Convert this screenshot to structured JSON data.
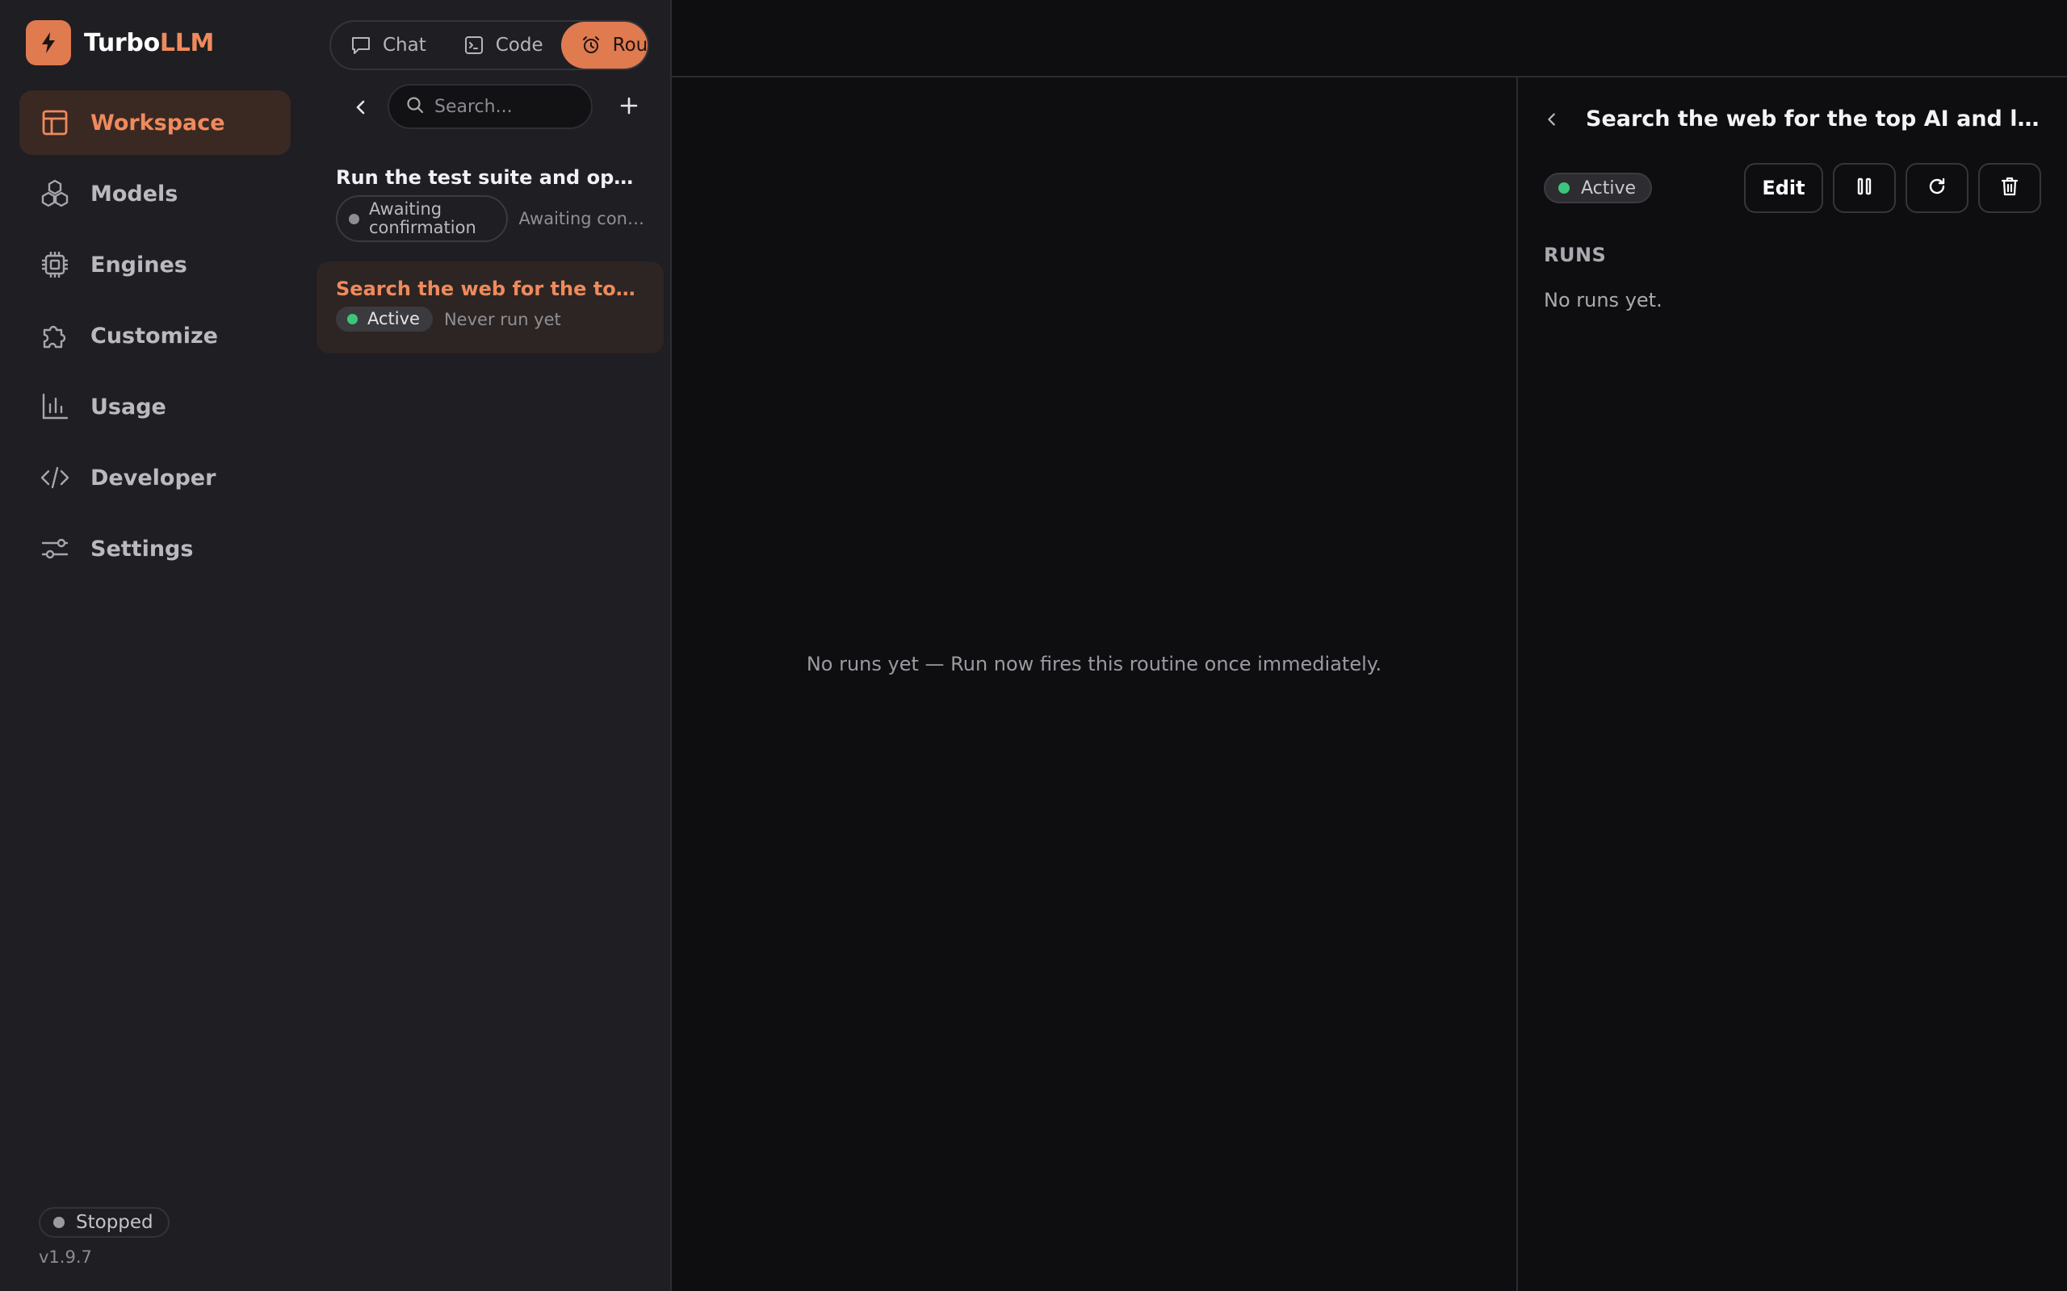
{
  "app": {
    "name_main": "Turbo",
    "name_accent": "LLM"
  },
  "nav": {
    "items": [
      {
        "id": "workspace",
        "label": "Workspace",
        "icon": "layout-icon"
      },
      {
        "id": "models",
        "label": "Models",
        "icon": "cubes-icon"
      },
      {
        "id": "engines",
        "label": "Engines",
        "icon": "cpu-icon"
      },
      {
        "id": "customize",
        "label": "Customize",
        "icon": "puzzle-icon"
      },
      {
        "id": "usage",
        "label": "Usage",
        "icon": "bar-chart-icon"
      },
      {
        "id": "developer",
        "label": "Developer",
        "icon": "code-icon"
      },
      {
        "id": "settings",
        "label": "Settings",
        "icon": "sliders-icon"
      }
    ],
    "active": "workspace"
  },
  "engine": {
    "status": "Stopped",
    "version": "v1.9.7"
  },
  "mode_tabs": {
    "chat": "Chat",
    "code": "Code",
    "routines": "Rout",
    "active": "routines"
  },
  "list": {
    "search_placeholder": "Search...",
    "routines": [
      {
        "title": "Run the test suite and open a ...",
        "status": "Awaiting confirmation",
        "subtext": "Awaiting conf..."
      },
      {
        "title": "Search the web for the top AI ...",
        "status": "Active",
        "subtext": "Never run yet"
      }
    ],
    "selected": 1
  },
  "main": {
    "empty_message": "No runs yet — Run now fires this routine once immediately."
  },
  "detail": {
    "title": "Search the web for the top AI and local-LL...",
    "status": "Active",
    "edit_label": "Edit",
    "runs_heading": "RUNS",
    "runs_empty": "No runs yet."
  },
  "colors": {
    "accent": "#e07a4f",
    "accent_text": "#ef8a5c",
    "active_dot": "#3ec57c",
    "inactive_dot": "#8d8d93",
    "sidebar_bg": "#1e1e23",
    "main_bg": "#0e0e11"
  }
}
